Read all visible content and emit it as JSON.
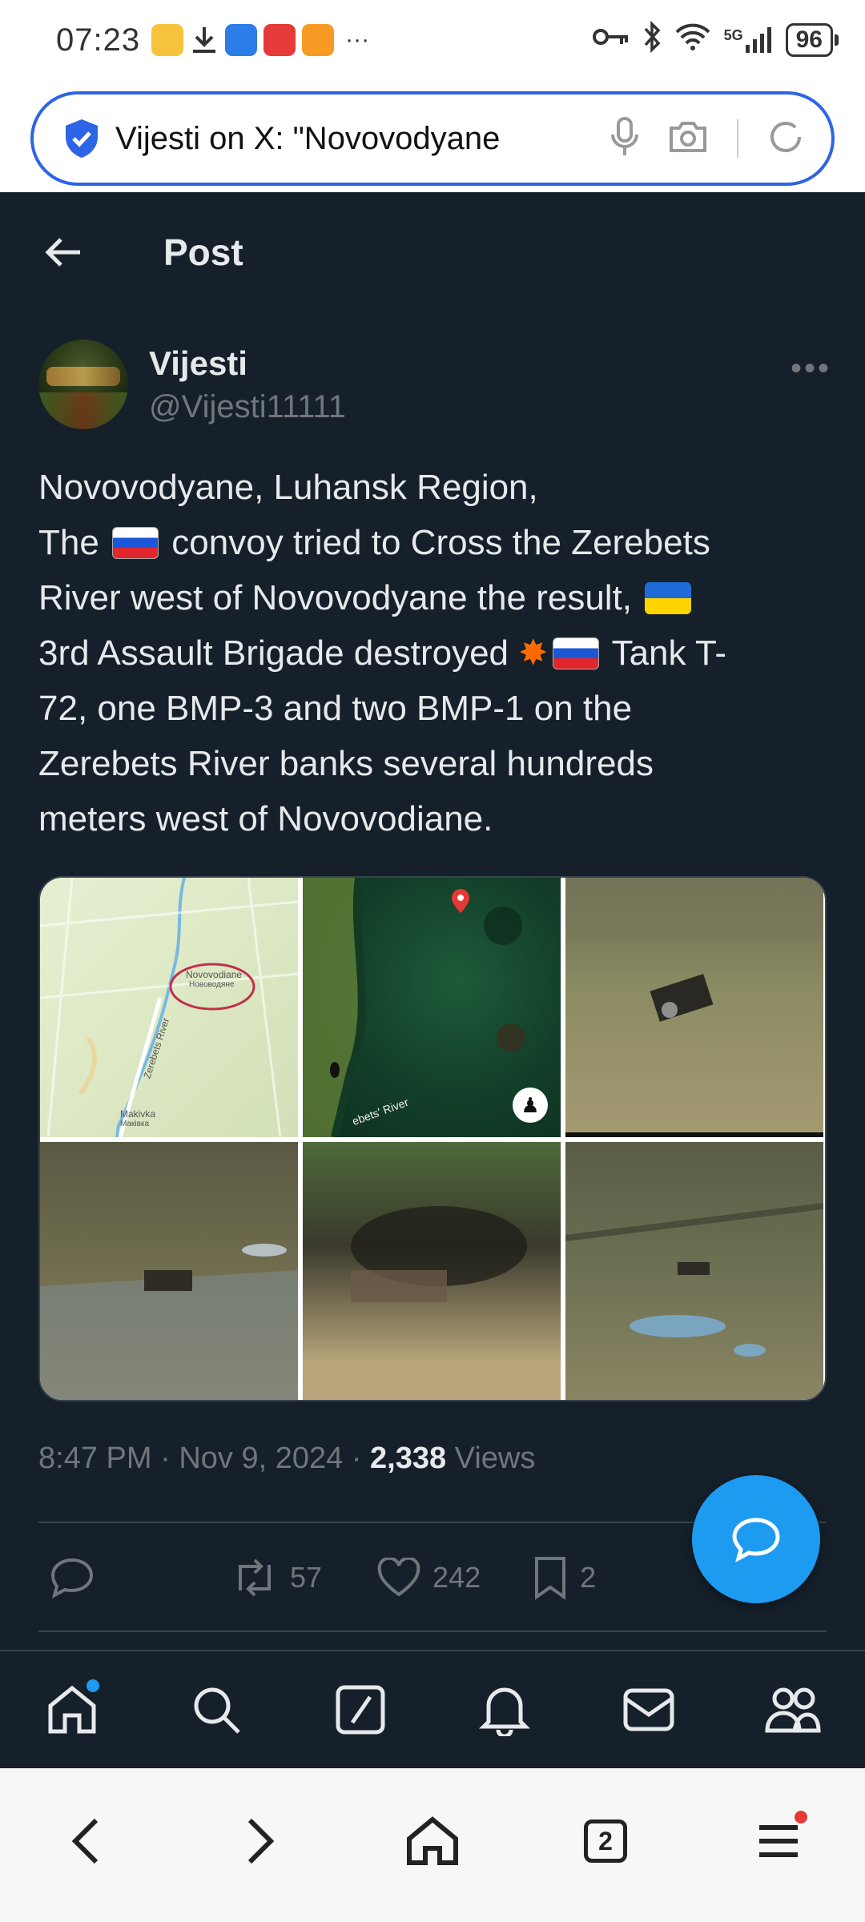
{
  "status_bar": {
    "time": "07:23",
    "more": "···",
    "network": "5G",
    "battery": "96"
  },
  "browser": {
    "url_text": "Vijesti on X: \"Novovodyane"
  },
  "header": {
    "title": "Post"
  },
  "author": {
    "name": "Vijesti",
    "handle": "@Vijesti11111"
  },
  "tweet": {
    "line1": "Novovodyane, Luhansk Region,",
    "line2_pre": "The",
    "line2_post": "convoy tried to Cross the Zerebets",
    "line3_pre": "River west of Novovodyane the result,",
    "line4_pre": "3rd Assault Brigade destroyed",
    "line4_post": "Tank T-",
    "line5": "72, one BMP-3 and two BMP-1 on the",
    "line6": "Zerebets River banks several hundreds",
    "line7": "meters west of Novovodiane."
  },
  "media": {
    "map_town": "Novovodiane",
    "map_town_cyr": "Нововодяне",
    "map_river": "Zerebets River",
    "map_village": "Makivka",
    "map_village_cyr": "Маківка",
    "sat_river": "ebets' River"
  },
  "meta": {
    "time": "8:47 PM",
    "date": "Nov 9, 2024",
    "views_count": "2,338",
    "views_label": "Views"
  },
  "actions": {
    "retweets": "57",
    "likes": "242",
    "bookmarks": "2"
  },
  "browser_nav": {
    "tab_count": "2"
  },
  "colors": {
    "background": "#15202b",
    "accent": "#1d9bf0",
    "text": "#e7e9ea",
    "muted": "#71767b"
  }
}
